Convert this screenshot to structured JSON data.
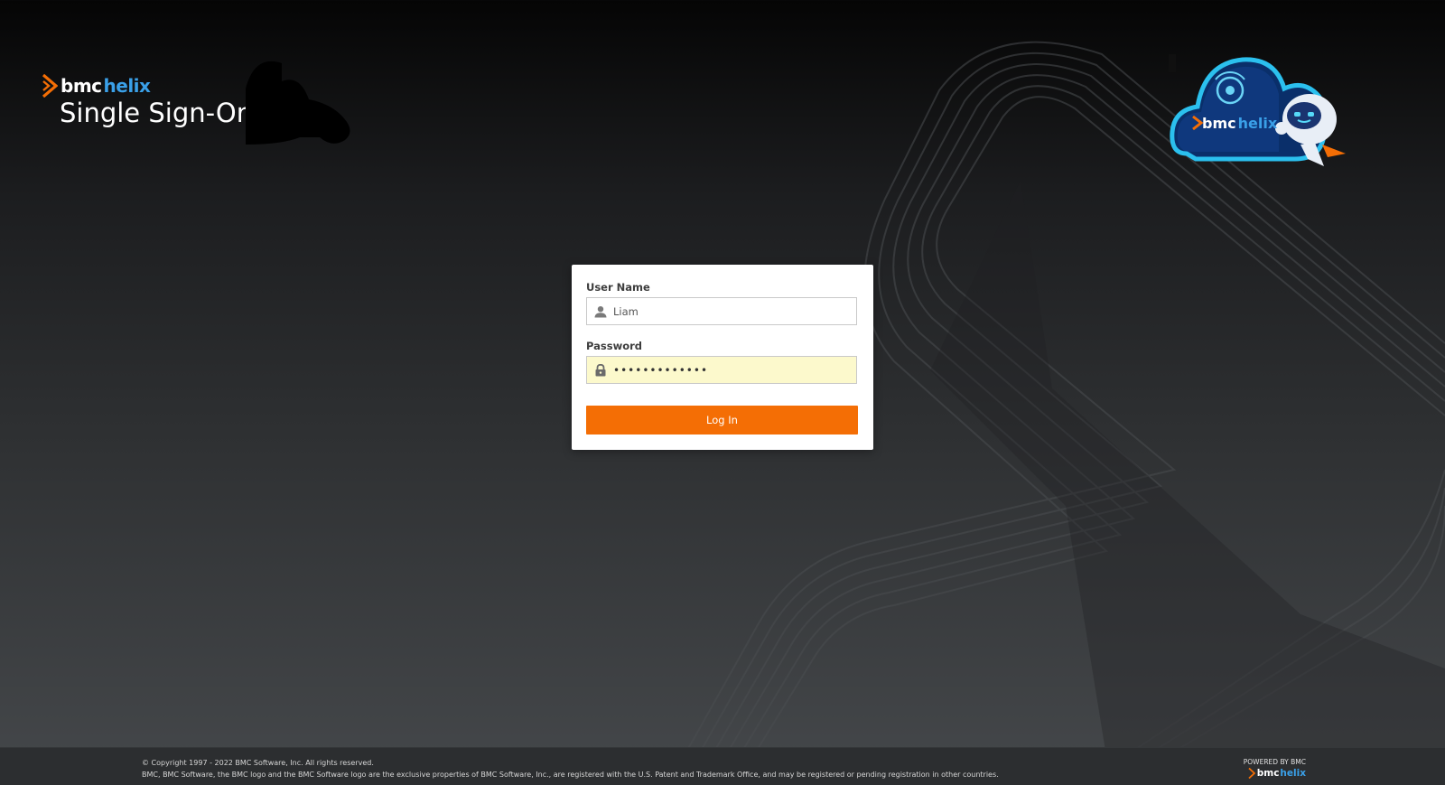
{
  "header": {
    "brand_bmc": "bmc",
    "brand_helix": "helix",
    "title": "Single Sign-On"
  },
  "mascot": {
    "brand_bmc": "bmc",
    "brand_helix": "helix"
  },
  "login": {
    "username_label": "User Name",
    "username_value": "Liam",
    "password_label": "Password",
    "password_value": "•••••••••••••",
    "login_button": "Log In"
  },
  "footer": {
    "copyright": "© Copyright 1997 - 2022 BMC Software, Inc. All rights reserved.",
    "legal": "BMC, BMC Software, the BMC logo and the BMC Software logo are the exclusive properties of BMC Software, Inc., are registered with the U.S. Patent and Trademark Office, and may be registered or pending registration in other countries.",
    "powered_by": "POWERED BY BMC",
    "logo_bmc": "bmc",
    "logo_helix": "helix"
  },
  "colors": {
    "accent": "#f46e05",
    "helix_blue": "#3aa0e8",
    "password_autofill_bg": "#fcf9cc",
    "footer_bg": "#2c2e30"
  },
  "icons": {
    "brand": "bmc-chevron-icon",
    "username": "user-icon",
    "password": "lock-icon"
  }
}
